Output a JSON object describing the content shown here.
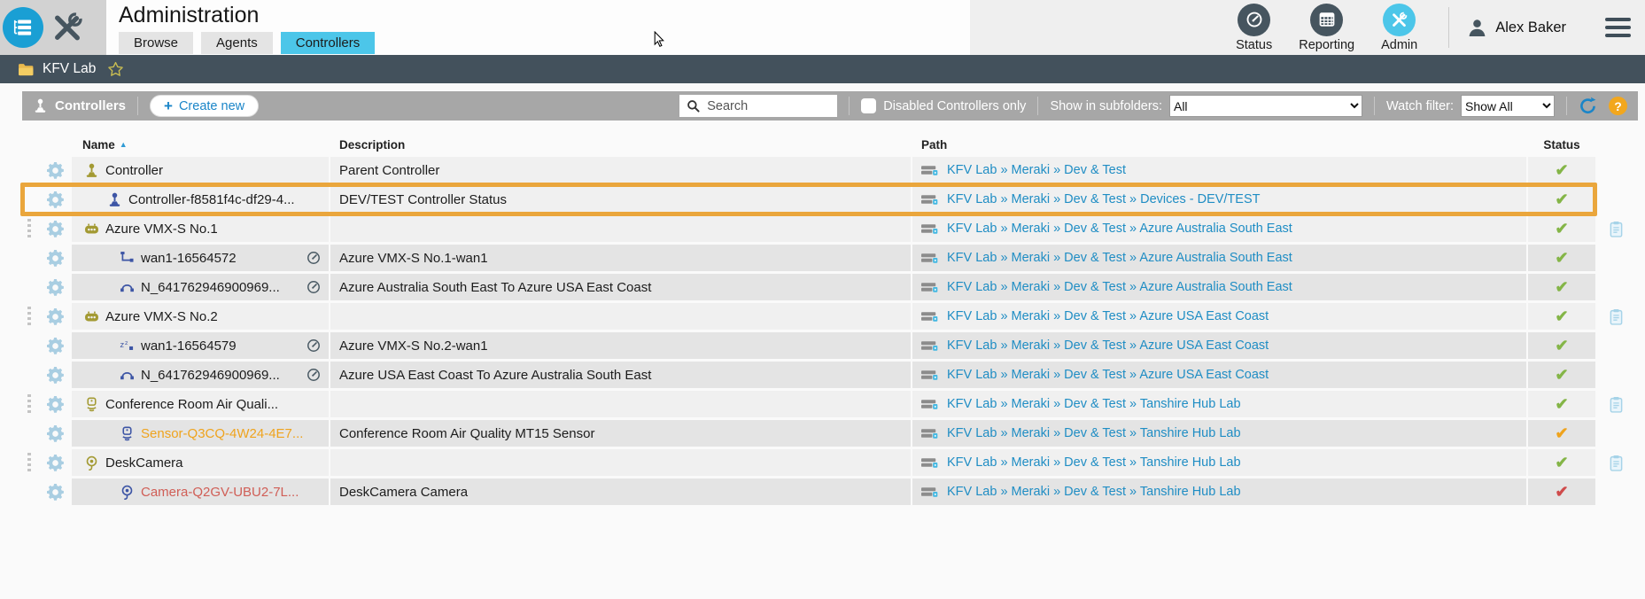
{
  "topbar": {
    "title": "Administration",
    "tabs": [
      {
        "label": "Browse",
        "active": false
      },
      {
        "label": "Agents",
        "active": false
      },
      {
        "label": "Controllers",
        "active": true
      }
    ],
    "nav": [
      {
        "label": "Status",
        "icon": "speedometer-icon",
        "active": false
      },
      {
        "label": "Reporting",
        "icon": "report-table-icon",
        "active": false
      },
      {
        "label": "Admin",
        "icon": "tools-icon",
        "active": true
      }
    ],
    "user": {
      "name": "Alex Baker"
    }
  },
  "breadcrumb": {
    "folder": "KFV Lab"
  },
  "toolbar": {
    "title": "Controllers",
    "create_button": "Create new",
    "search_placeholder": "Search",
    "checkbox_label": "Disabled Controllers only",
    "subfolders_label": "Show in subfolders:",
    "subfolders_value": "All",
    "watch_label": "Watch filter:",
    "watch_value": "Show All"
  },
  "table": {
    "columns": [
      "Name",
      "Description",
      "Path",
      "Status"
    ],
    "sort_column": "Name",
    "sort_direction": "asc",
    "rows": [
      {
        "name": "Controller",
        "name_color": "default",
        "icon": "joystick",
        "icon_color": "olive",
        "indent": 0,
        "expander": false,
        "gauge": false,
        "description": "Parent Controller",
        "path": "KFV Lab » Meraki » Dev & Test",
        "status": "ok",
        "clipboard": false,
        "shade": "light",
        "highlighted": false
      },
      {
        "name": "Controller-f8581f4c-df29-4...",
        "name_color": "default",
        "icon": "joystick",
        "icon_color": "blue",
        "indent": 1,
        "expander": false,
        "gauge": false,
        "description": "DEV/TEST Controller Status",
        "path": "KFV Lab » Meraki » Dev & Test » Devices - DEV/TEST",
        "status": "ok",
        "clipboard": false,
        "shade": "light",
        "highlighted": true
      },
      {
        "name": "Azure VMX-S No.1",
        "name_color": "default",
        "icon": "robot",
        "icon_color": "olive",
        "indent": 0,
        "expander": true,
        "gauge": false,
        "description": "",
        "path": "KFV Lab » Meraki » Dev & Test » Azure Australia South East",
        "status": "ok",
        "clipboard": true,
        "shade": "light",
        "highlighted": false
      },
      {
        "name": "wan1-16564572",
        "name_color": "default",
        "icon": "wan",
        "icon_color": "blue",
        "indent": 2,
        "expander": false,
        "gauge": true,
        "description": "Azure VMX-S No.1-wan1",
        "path": "KFV Lab » Meraki » Dev & Test » Azure Australia South East",
        "status": "ok",
        "clipboard": false,
        "shade": "dark",
        "highlighted": false
      },
      {
        "name": "N_641762946900969...",
        "name_color": "default",
        "icon": "netpath",
        "icon_color": "blue",
        "indent": 2,
        "expander": false,
        "gauge": true,
        "description": "Azure Australia South East To Azure USA East Coast",
        "path": "KFV Lab » Meraki » Dev & Test » Azure Australia South East",
        "status": "ok",
        "clipboard": false,
        "shade": "dark",
        "highlighted": false
      },
      {
        "name": "Azure VMX-S No.2",
        "name_color": "default",
        "icon": "robot",
        "icon_color": "olive",
        "indent": 0,
        "expander": true,
        "gauge": false,
        "description": "",
        "path": "KFV Lab » Meraki » Dev & Test » Azure USA East Coast",
        "status": "ok",
        "clipboard": true,
        "shade": "light",
        "highlighted": false
      },
      {
        "name": "wan1-16564579",
        "name_color": "default",
        "icon": "sleep",
        "icon_color": "blue",
        "indent": 2,
        "expander": false,
        "gauge": true,
        "description": "Azure VMX-S No.2-wan1",
        "path": "KFV Lab » Meraki » Dev & Test » Azure USA East Coast",
        "status": "ok",
        "clipboard": false,
        "shade": "dark",
        "highlighted": false
      },
      {
        "name": "N_641762946900969...",
        "name_color": "default",
        "icon": "netpath",
        "icon_color": "blue",
        "indent": 2,
        "expander": false,
        "gauge": true,
        "description": "Azure USA East Coast To Azure Australia South East",
        "path": "KFV Lab » Meraki » Dev & Test » Azure USA East Coast",
        "status": "ok",
        "clipboard": false,
        "shade": "dark",
        "highlighted": false
      },
      {
        "name": "Conference Room Air Quali...",
        "name_color": "default",
        "icon": "sensor",
        "icon_color": "olive",
        "indent": 0,
        "expander": true,
        "gauge": false,
        "description": "",
        "path": "KFV Lab » Meraki » Dev & Test » Tanshire Hub Lab",
        "status": "ok",
        "clipboard": true,
        "shade": "light",
        "highlighted": false
      },
      {
        "name": "Sensor-Q3CQ-4W24-4E7...",
        "name_color": "orange",
        "icon": "sensor",
        "icon_color": "blue",
        "indent": 2,
        "expander": false,
        "gauge": false,
        "description": "Conference Room Air Quality MT15 Sensor",
        "path": "KFV Lab » Meraki » Dev & Test » Tanshire Hub Lab",
        "status": "warning",
        "clipboard": false,
        "shade": "dark",
        "highlighted": false
      },
      {
        "name": "DeskCamera",
        "name_color": "default",
        "icon": "camera",
        "icon_color": "olive",
        "indent": 0,
        "expander": true,
        "gauge": false,
        "description": "",
        "path": "KFV Lab » Meraki » Dev & Test » Tanshire Hub Lab",
        "status": "ok",
        "clipboard": true,
        "shade": "light",
        "highlighted": false
      },
      {
        "name": "Camera-Q2GV-UBU2-7L...",
        "name_color": "red",
        "icon": "camera",
        "icon_color": "blue",
        "indent": 2,
        "expander": false,
        "gauge": false,
        "description": "DeskCamera Camera",
        "path": "KFV Lab » Meraki » Dev & Test » Tanshire Hub Lab",
        "status": "error",
        "clipboard": false,
        "shade": "dark",
        "highlighted": false
      }
    ]
  },
  "icons": {
    "check": "✔",
    "sort_asc": "▲",
    "help": "?",
    "plus": "+"
  },
  "colors": {
    "accent_cyan": "#4cc6e9",
    "slate": "#46555f",
    "olive_icon": "#a39a33",
    "blue_icon": "#3d55a5",
    "link_blue": "#1f8dc4",
    "ok_green": "#84b547",
    "warning_orange": "#efa31d",
    "error_red": "#cf4b4b",
    "highlight_border": "#eaa63c",
    "toolbar_gray": "#a7a7a7",
    "breadcrumb_bg": "#43515c",
    "help_orange": "#f2a71e"
  }
}
